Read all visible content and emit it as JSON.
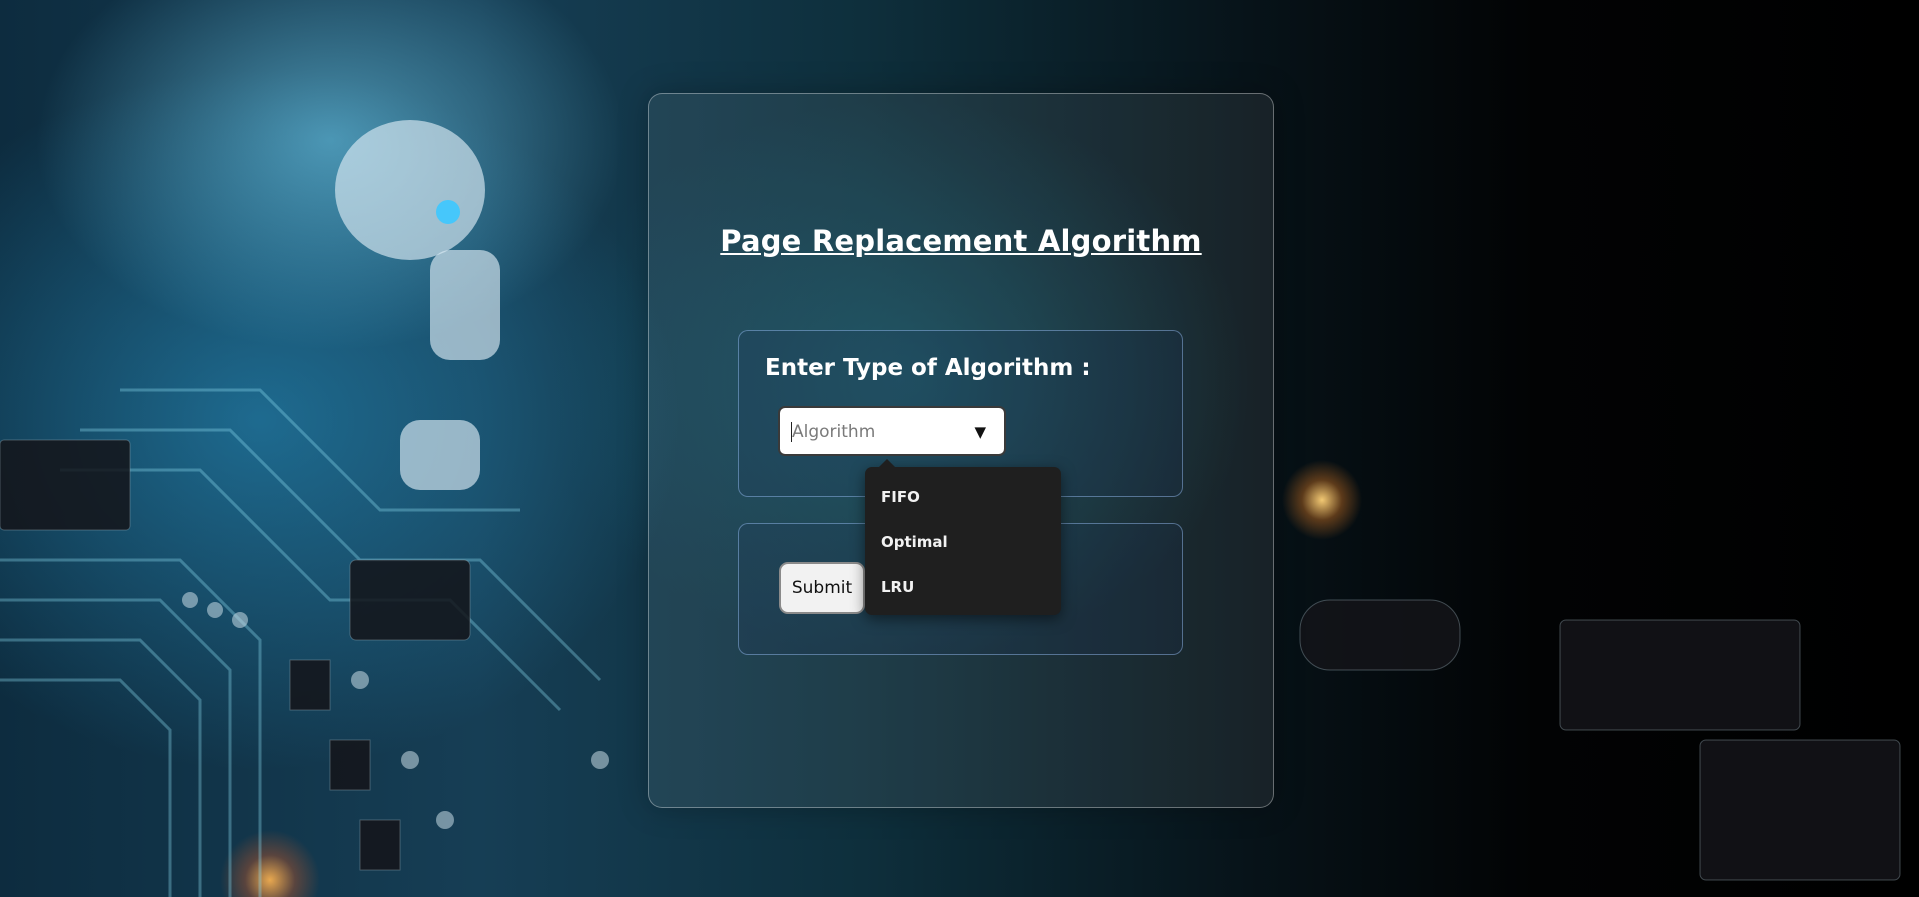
{
  "page": {
    "title": "Page Replacement Algorithm"
  },
  "form": {
    "algorithm_label": "Enter Type of Algorithm :",
    "select_placeholder": "Algorithm",
    "select_arrow": "▼",
    "options": [
      "FIFO",
      "Optimal",
      "LRU"
    ],
    "submit_label": "Submit"
  }
}
